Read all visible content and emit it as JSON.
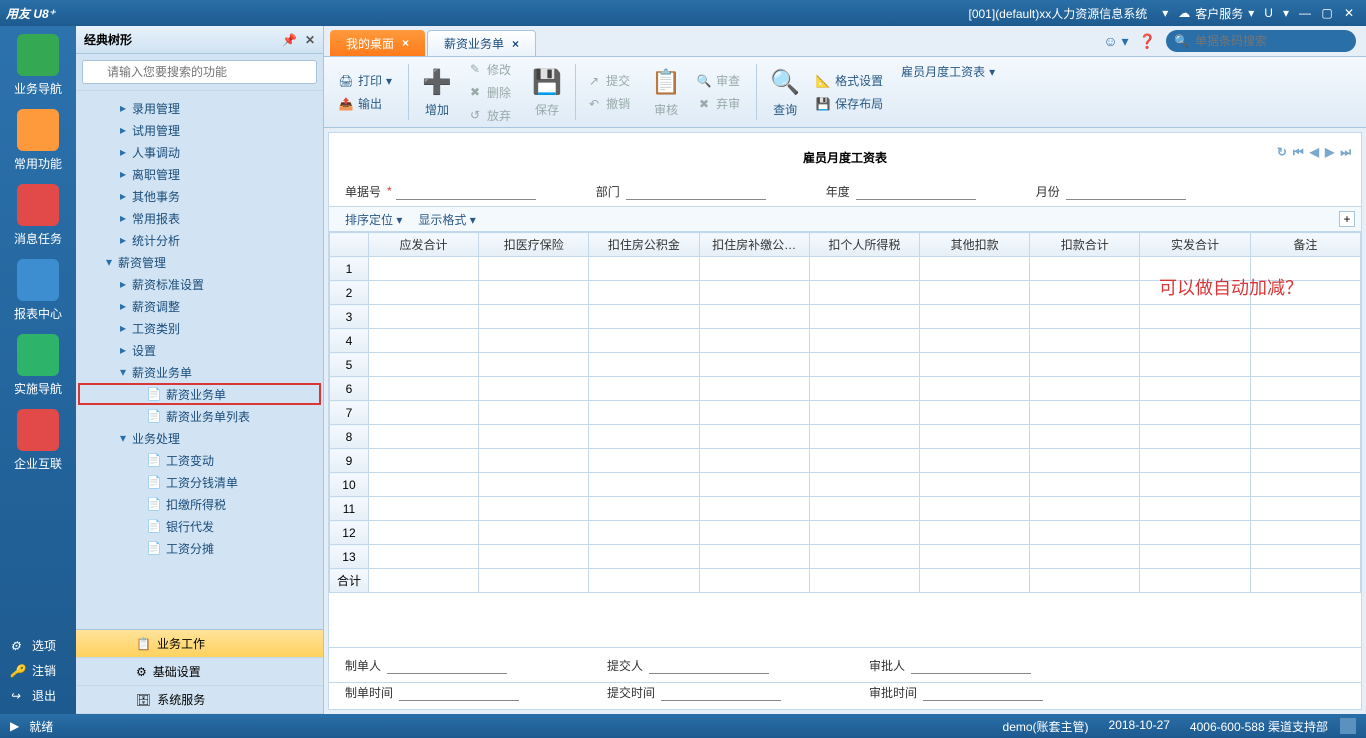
{
  "titlebar": {
    "logo": "用友 U8⁺",
    "system": "[001](default)xx人力资源信息系统",
    "service": "客户服务",
    "u": "U"
  },
  "dock": {
    "items": [
      {
        "label": "业务导航",
        "color": "#34a853"
      },
      {
        "label": "常用功能",
        "color": "#ff9a3c"
      },
      {
        "label": "消息任务",
        "color": "#e24a4a"
      },
      {
        "label": "报表中心",
        "color": "#3c8ed0"
      },
      {
        "label": "实施导航",
        "color": "#2db36a"
      },
      {
        "label": "企业互联",
        "color": "#e24a4a"
      }
    ],
    "bottom": [
      {
        "icon": "⚙",
        "label": "选项"
      },
      {
        "icon": "🔑",
        "label": "注销"
      },
      {
        "icon": "↪",
        "label": "退出"
      }
    ]
  },
  "tree": {
    "title": "经典树形",
    "search_ph": "请输入您要搜索的功能",
    "nodes": [
      {
        "lvl": 2,
        "arrow": "▸",
        "label": "录用管理"
      },
      {
        "lvl": 2,
        "arrow": "▸",
        "label": "试用管理"
      },
      {
        "lvl": 2,
        "arrow": "▸",
        "label": "人事调动"
      },
      {
        "lvl": 2,
        "arrow": "▸",
        "label": "离职管理"
      },
      {
        "lvl": 2,
        "arrow": "▸",
        "label": "其他事务"
      },
      {
        "lvl": 2,
        "arrow": "▸",
        "label": "常用报表"
      },
      {
        "lvl": 2,
        "arrow": "▸",
        "label": "统计分析"
      },
      {
        "lvl": 1,
        "arrow": "▾",
        "label": "薪资管理"
      },
      {
        "lvl": 2,
        "arrow": "▸",
        "label": "薪资标准设置"
      },
      {
        "lvl": 2,
        "arrow": "▸",
        "label": "薪资调整"
      },
      {
        "lvl": 2,
        "arrow": "▸",
        "label": "工资类别"
      },
      {
        "lvl": 2,
        "arrow": "▸",
        "label": "设置"
      },
      {
        "lvl": 2,
        "arrow": "▾",
        "label": "薪资业务单"
      },
      {
        "lvl": 3,
        "arrow": "",
        "label": "薪资业务单",
        "icon": "doc",
        "hl": true
      },
      {
        "lvl": 3,
        "arrow": "",
        "label": "薪资业务单列表",
        "icon": "doc"
      },
      {
        "lvl": 2,
        "arrow": "▾",
        "label": "业务处理"
      },
      {
        "lvl": 3,
        "arrow": "",
        "label": "工资变动",
        "icon": "doc"
      },
      {
        "lvl": 3,
        "arrow": "",
        "label": "工资分钱清单",
        "icon": "doc"
      },
      {
        "lvl": 3,
        "arrow": "",
        "label": "扣缴所得税",
        "icon": "doc"
      },
      {
        "lvl": 3,
        "arrow": "",
        "label": "银行代发",
        "icon": "doc"
      },
      {
        "lvl": 3,
        "arrow": "",
        "label": "工资分摊",
        "icon": "doc"
      }
    ],
    "footer": [
      {
        "label": "业务工作",
        "icon": "📋",
        "active": true
      },
      {
        "label": "基础设置",
        "icon": "⚙"
      },
      {
        "label": "系统服务",
        "icon": "🗄"
      }
    ]
  },
  "tabs": {
    "desktop": "我的桌面",
    "active": "薪资业务单",
    "search_ph": "单据条码搜索"
  },
  "ribbon": {
    "print": "打印",
    "output": "输出",
    "add": "增加",
    "modify": "修改",
    "delete": "删除",
    "abandon": "放弃",
    "save": "保存",
    "submit": "提交",
    "revoke": "撤销",
    "audit": "审核",
    "review": "审查",
    "unaudit": "弃审",
    "query": "查询",
    "format": "格式设置",
    "savelayout": "保存布局",
    "report": "雇员月度工资表"
  },
  "doc": {
    "title": "雇员月度工资表",
    "fields": {
      "billno": "单据号",
      "dept": "部门",
      "year": "年度",
      "month": "月份"
    },
    "sort": "排序定位",
    "dispfmt": "显示格式",
    "cols": [
      "应发合计",
      "扣医疗保险",
      "扣住房公积金",
      "扣住房补缴公…",
      "扣个人所得税",
      "其他扣款",
      "扣款合计",
      "实发合计",
      "备注"
    ],
    "rows": 13,
    "total": "合计",
    "annotation": "可以做自动加减？",
    "footer": {
      "creator": "制单人",
      "submitter": "提交人",
      "approver": "审批人",
      "ctime": "制单时间",
      "stime": "提交时间",
      "atime": "审批时间"
    }
  },
  "status": {
    "ready": "就绪",
    "user": "demo(账套主管)",
    "date": "2018-10-27",
    "phone": "4006-600-588 渠道支持部"
  }
}
